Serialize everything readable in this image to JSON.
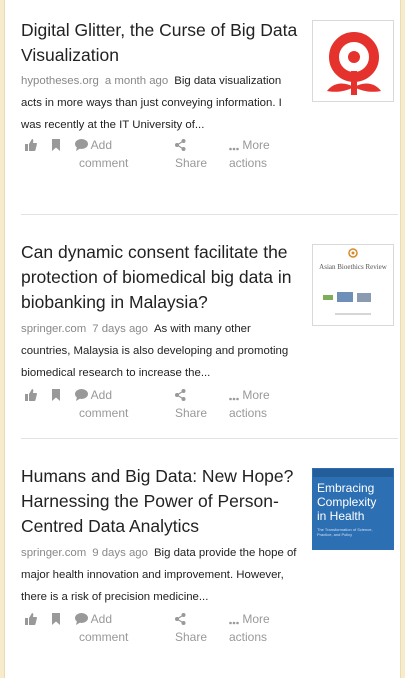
{
  "articles": [
    {
      "title": "Digital Glitter, the Curse of Big Data Visualization",
      "source": "hypotheses.org",
      "age": "a month ago",
      "snippet": "Big data visualization acts in more ways than just conveying information. I was recently at the IT University of...",
      "thumb_icon": "hypotheses-logo-icon"
    },
    {
      "title": "Can dynamic consent facilitate the protection of biomedical big data in biobanking in Malaysia?",
      "source": "springer.com",
      "age": "7 days ago",
      "snippet": "As with many other countries, Malaysia is also developing and promoting biomedical research to increase the...",
      "thumb_icon": "journal-cover-icon",
      "thumb_text": "Asian Bioethics Review"
    },
    {
      "title": "Humans and Big Data: New Hope? Harnessing the Power of Person-Centred Data Analytics",
      "source": "springer.com",
      "age": "9 days ago",
      "snippet": "Big data provide the hope of major health innovation and improvement. However, there is a risk of precision medicine...",
      "thumb_icon": "book-cover-icon",
      "thumb_text": "Embracing Complexity in Health",
      "thumb_subtext": "The Transformation of Science, Practice, and Policy"
    }
  ],
  "actions": {
    "like_icon": "thumbs-up-icon",
    "bookmark_icon": "bookmark-icon",
    "comment_icon": "comment-icon",
    "share_icon": "share-icon",
    "more_icon": "ellipsis-icon",
    "add_comment_line1": "Add",
    "add_comment_line2": "comment",
    "share_label": "Share",
    "more_line1": "More",
    "more_line2": "actions"
  },
  "colors": {
    "background": "#f6eccb",
    "logo_red": "#e5322d",
    "book_blue": "#2c6fb3",
    "muted_text": "#888888",
    "action_text": "#999999"
  }
}
